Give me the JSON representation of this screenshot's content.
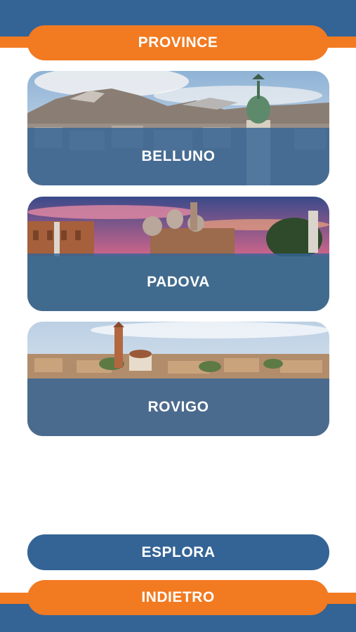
{
  "header": {
    "title": "PROVINCE"
  },
  "provinces": [
    {
      "label": "BELLUNO"
    },
    {
      "label": "PADOVA"
    },
    {
      "label": "ROVIGO"
    }
  ],
  "actions": {
    "explore_label": "ESPLORA",
    "back_label": "INDIETRO"
  },
  "colors": {
    "brand_blue": "#346496",
    "brand_orange": "#f27a21",
    "background": "#ffffff"
  }
}
